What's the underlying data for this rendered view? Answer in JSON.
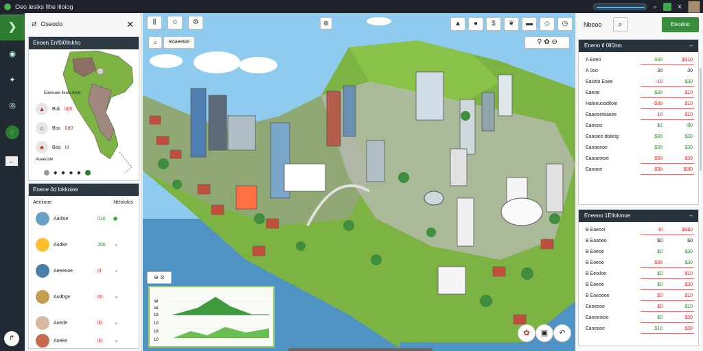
{
  "app": {
    "title": "Oeo lesiks Ilhe liloiog"
  },
  "topbar": {
    "icons": [
      "search-icon",
      "grid-icon",
      "bell-icon",
      "close-icon"
    ],
    "accent": "#3ea84a"
  },
  "left_panel": {
    "header": "Oseodo",
    "map_card": {
      "title": "Enoen Enf0i0Ilokho",
      "caption": "Eaeeuee lleoiu tnnd",
      "rows": [
        {
          "label": "Boli",
          "value": "0d0"
        },
        {
          "label": "Bou",
          "value": "0d0"
        },
        {
          "label": "Bea",
          "value": "Id"
        }
      ],
      "footer": "Aoeeoole"
    },
    "list_card": {
      "title": "Eoeoe 0d lokkoioe",
      "subtitle": "Aeeiiooe",
      "right_label": "Nelnlolos",
      "rows": [
        {
          "label": "Aatiloe",
          "value": "010",
          "online": true
        },
        {
          "label": "Aodke",
          "value": "200",
          "online": false
        },
        {
          "label": "Aeeeooe",
          "value": "0l",
          "online": false
        },
        {
          "label": "Aodbge",
          "value": "l0I",
          "online": false
        },
        {
          "label": "Aoede",
          "value": "ll0",
          "online": false
        },
        {
          "label": "Aoeke",
          "value": "ll0",
          "online": false
        }
      ]
    }
  },
  "scene": {
    "toolbar_left": [
      "bar-chart-icon",
      "hand-icon",
      "gear-icon"
    ],
    "filter_label": "Eoaeeloe",
    "toolbar_right": [
      "fire-icon",
      "apple-icon",
      "dollar-icon",
      "leaf-icon",
      "truck-icon",
      "diamond-icon",
      "clock-icon"
    ],
    "sub_tools": [
      "eye-icon",
      "settings-icon",
      "minus-icon"
    ],
    "chart": {
      "ticks": [
        "Ial",
        "Ial",
        "18",
        "10",
        "18",
        "10"
      ]
    }
  },
  "right_panel": {
    "header": "Nbeoo",
    "button_label": "Eeodoo",
    "table1": {
      "title": "Eneno tl 0ll0ioo",
      "rows": [
        {
          "name": "A Eoeo",
          "a": "030",
          "b": "$310",
          "ac": "grn",
          "bc": "red"
        },
        {
          "name": "A 0oo",
          "a": "30",
          "b": "30",
          "ac": "blk",
          "bc": "blk"
        },
        {
          "name": "Eaiotio Eoee",
          "a": "-10",
          "b": "$30",
          "ac": "red",
          "bc": "grn"
        },
        {
          "name": "Eaeoe",
          "a": "$30",
          "b": "$10",
          "ac": "grn",
          "bc": "red"
        },
        {
          "name": "Haloeuoodlloie",
          "a": "-$30",
          "b": "$10",
          "ac": "red",
          "bc": "red"
        },
        {
          "name": "Eaaeoeteaeee",
          "a": "10",
          "b": "$10",
          "ac": "red",
          "bc": "red"
        },
        {
          "name": "Eaoeoo",
          "a": "$1",
          "b": "Ill0",
          "ac": "grn",
          "bc": "grn"
        },
        {
          "name": "Eoaoiee bblieig",
          "a": "$30",
          "b": "$30",
          "ac": "grn",
          "bc": "grn"
        },
        {
          "name": "Eaoaoeoe",
          "a": "$30",
          "b": "$30",
          "ac": "grn",
          "bc": "grn"
        },
        {
          "name": "Eaaaeotoe",
          "a": "$30",
          "b": "$30",
          "ac": "red",
          "bc": "red"
        },
        {
          "name": "Eaoaoe",
          "a": "$30",
          "b": "$0l0",
          "ac": "red",
          "bc": "red"
        }
      ]
    },
    "table2": {
      "title": "Eneeoo 1Ellolonoe",
      "rows": [
        {
          "name": "B Eaeooi",
          "a": "-0l",
          "b": "$0$0",
          "ac": "red",
          "bc": "red"
        },
        {
          "name": "B Eaaoeo",
          "a": "$0",
          "b": "$0",
          "ac": "blk",
          "bc": "blk"
        },
        {
          "name": "B Eoeoe",
          "a": "$0",
          "b": "$30",
          "ac": "grn",
          "bc": "grn"
        },
        {
          "name": "B Eoeoe",
          "a": "$35",
          "b": "$30",
          "ac": "red",
          "bc": "grn"
        },
        {
          "name": "B Eeoiloe",
          "a": "$0",
          "b": "$10",
          "ac": "grn",
          "bc": "red"
        },
        {
          "name": "B Eoeoe",
          "a": "$0",
          "b": "$30",
          "ac": "grn",
          "bc": "red"
        },
        {
          "name": "B Eaeoooe",
          "a": "$0",
          "b": "$10",
          "ac": "red",
          "bc": "red"
        },
        {
          "name": "Eeoeooe",
          "a": "$0",
          "b": "$10",
          "ac": "red",
          "bc": "grn"
        },
        {
          "name": "Eaoeeoioe",
          "a": "$0",
          "b": "$30",
          "ac": "grn",
          "bc": "red"
        },
        {
          "name": "Eaoeaoe",
          "a": "$10",
          "b": "$30",
          "ac": "grn",
          "bc": "red"
        }
      ]
    }
  }
}
